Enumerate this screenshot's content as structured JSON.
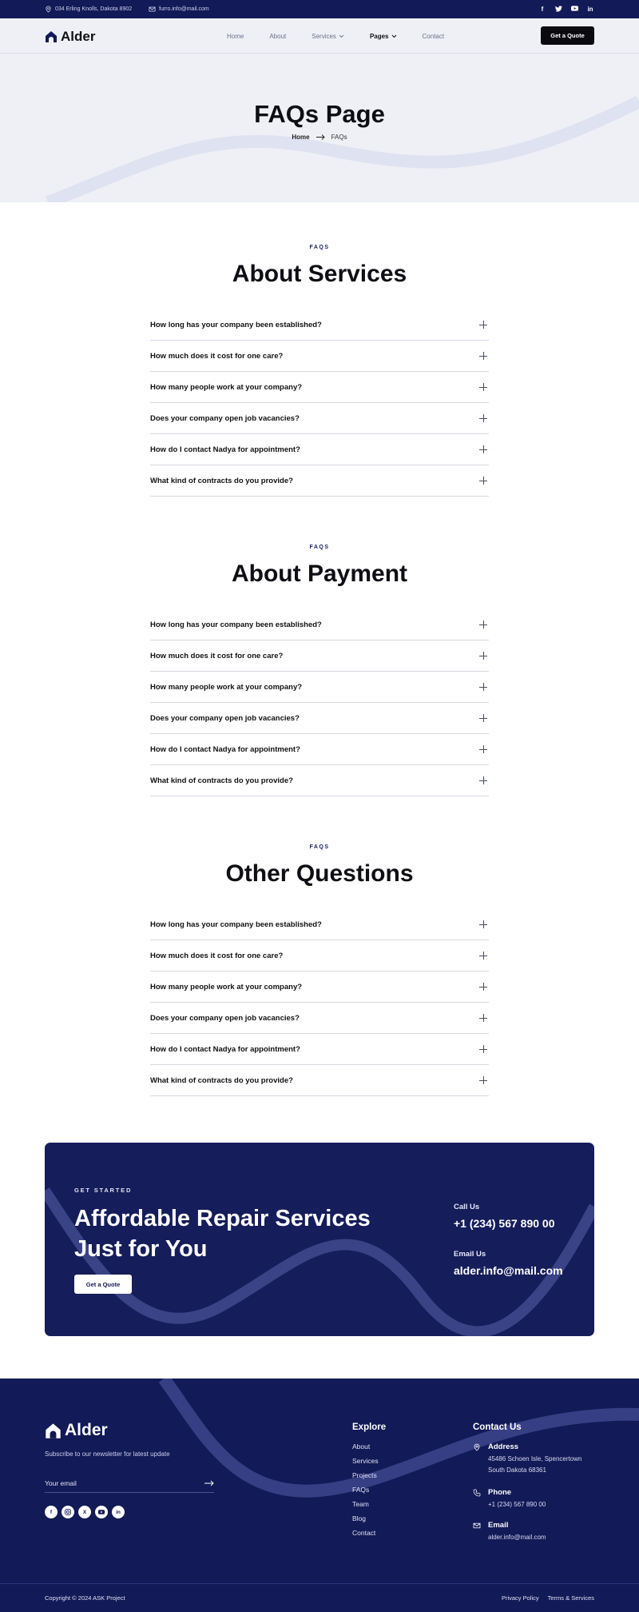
{
  "topbar": {
    "address": "034 Erling Knolls, Dakota 8902",
    "email": "furro.info@mail.com",
    "socials": [
      "f",
      "t",
      "yt",
      "in"
    ]
  },
  "nav": {
    "brand": "Alder",
    "items": [
      {
        "label": "Home"
      },
      {
        "label": "About"
      },
      {
        "label": "Services"
      },
      {
        "label": "Pages"
      },
      {
        "label": "Contact"
      }
    ],
    "cta": "Get a Quote"
  },
  "hero": {
    "title": "FAQs Page",
    "breadcrumb_home": "Home",
    "breadcrumb_current": "FAQs"
  },
  "sections": [
    {
      "eyebrow": "FAQS",
      "title": "About Services",
      "questions": [
        "How long has your company been established?",
        "How much does it cost for one care?",
        "How many people work at your company?",
        "Does your company open job vacancies?",
        "How do I contact Nadya for appointment?",
        "What kind of contracts do you provide?"
      ]
    },
    {
      "eyebrow": "FAQS",
      "title": "About Payment",
      "questions": [
        "How long has your company been established?",
        "How much does it cost for one care?",
        "How many people work at your company?",
        "Does your company open job vacancies?",
        "How do I contact Nadya for appointment?",
        "What kind of contracts do you provide?"
      ]
    },
    {
      "eyebrow": "FAQS",
      "title": "Other Questions",
      "questions": [
        "How long has your company been established?",
        "How much does it cost for one care?",
        "How many people work at your company?",
        "Does your company open job vacancies?",
        "How do I contact Nadya for appointment?",
        "What kind of contracts do you provide?"
      ]
    }
  ],
  "cta_band": {
    "eyebrow": "GET STARTED",
    "title": "Affordable Repair Services Just for You",
    "button": "Get a Quote",
    "call_label": "Call Us",
    "call_value": "+1 (234) 567 890 00",
    "email_label": "Email Us",
    "email_value": "alder.info@mail.com"
  },
  "footer": {
    "brand": "Alder",
    "subscribe_text": "Subscribe to our newsletter for latest update",
    "email_placeholder": "Your email",
    "socials": [
      "f",
      "ig",
      "x",
      "yt",
      "in"
    ],
    "explore_title": "Explore",
    "explore_links": [
      "About",
      "Services",
      "Projects",
      "FAQs",
      "Team",
      "Blog",
      "Contact"
    ],
    "contact_title": "Contact Us",
    "address_label": "Address",
    "address_line1": "45486 Schoen Isle, Spencertown",
    "address_line2": "South Dakota 68361",
    "phone_label": "Phone",
    "phone_value": "+1 (234) 567 890 00",
    "email_label": "Email",
    "email_value": "alder.info@mail.com",
    "copyright": "Copyright © 2024 ASK Project",
    "privacy": "Privacy Policy",
    "terms": "Terms & Services"
  }
}
